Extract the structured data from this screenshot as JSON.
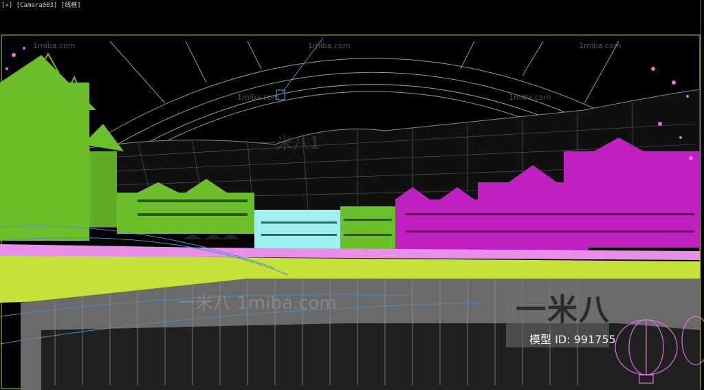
{
  "viewport": {
    "label_plus": "[+]",
    "label_camera": "[Camera003]",
    "label_mode": "[线框]",
    "frame_color": "#c8c820"
  },
  "watermarks": {
    "small": [
      "1miba.com",
      "1miba.com",
      "1miba.com",
      "1miba.com",
      "1miba.com"
    ],
    "big": "一米八 1miba.com",
    "mid": "一米八1"
  },
  "logo": {
    "brand": "一米八",
    "model_id": "模型 ID: 991755"
  },
  "colors": {
    "building_green": "#6abf2a",
    "building_magenta": "#c020c0",
    "building_cyan": "#9ff0f0",
    "ground_gray": "#6a6a6a",
    "wire_gray": "#b8b8b8",
    "wire_blue": "#4a8fc8",
    "lime": "#c4e23a",
    "pink": "#e890e8"
  }
}
